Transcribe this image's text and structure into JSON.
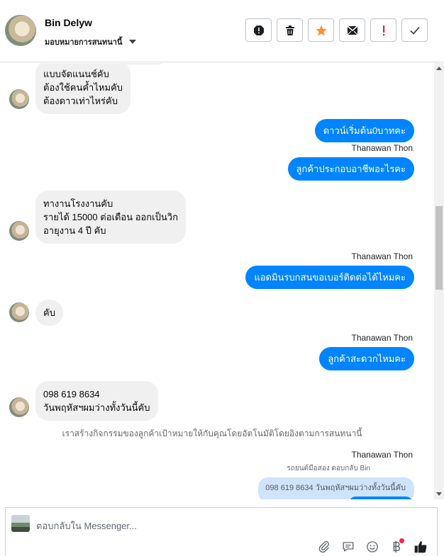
{
  "header": {
    "name": "Bin Delyw",
    "subtitle": "มอบหมายการสนทนานี้",
    "actions": [
      {
        "name": "report-icon"
      },
      {
        "name": "trash-icon"
      },
      {
        "name": "star-icon",
        "color": "#f7923a"
      },
      {
        "name": "mark-unread-icon"
      },
      {
        "name": "follow-up-icon",
        "color": "#e41e3f"
      },
      {
        "name": "check-icon"
      }
    ]
  },
  "messages": [
    {
      "dir": "in",
      "lines": [
        "แบบจัดแนนช์คับ",
        "ต้องใช้คนค้ำไหมคับ",
        "ต้องดาวเท่าไหร่คับ"
      ]
    },
    {
      "dir": "out",
      "text": "ดาวน์เริ่มต้น0บาทคะ"
    },
    {
      "dir": "out",
      "sender": "Thanawan Thon",
      "text": "ลูกค้าประกอบอาชีพอะไรคะ"
    },
    {
      "dir": "in",
      "lines": [
        "ทางานโรงงานคับ",
        "รายได้ 15000 ต่อเดือน ออกเป็นวิก",
        "อายุงาน 4 ปี คับ"
      ]
    },
    {
      "dir": "out",
      "sender": "Thanawan Thon",
      "text": "แอดมินรบกสนขอเบอร์ติดต่อได้ไหมคะ"
    },
    {
      "dir": "in",
      "lines": [
        "คับ"
      ]
    },
    {
      "dir": "out",
      "sender": "Thanawan Thon",
      "text": "ลูกค้าสะดวกไหมคะ"
    },
    {
      "dir": "in",
      "lines": [
        "098 619 8634",
        "วันพฤหัสฯผมว่างทั้งวันนี้คับ"
      ]
    }
  ],
  "notice": "เราสร้างกิจกรรมของลูกค้าเป้าหมายให้กับคุณโดยอัตโนมัติโดยอิงตามการสนทนานี้",
  "last_sender": "Thanawan Thon",
  "reply_meta": "รถยนต์มือสอง ตอบกลับ Bin",
  "quoted": "098 619 8634 วันพฤหัสฯผมว่างทั้งวันนี้คับ",
  "composer": {
    "placeholder": "ตอบกลับใน Messenger..."
  },
  "accent": "#0084ff"
}
